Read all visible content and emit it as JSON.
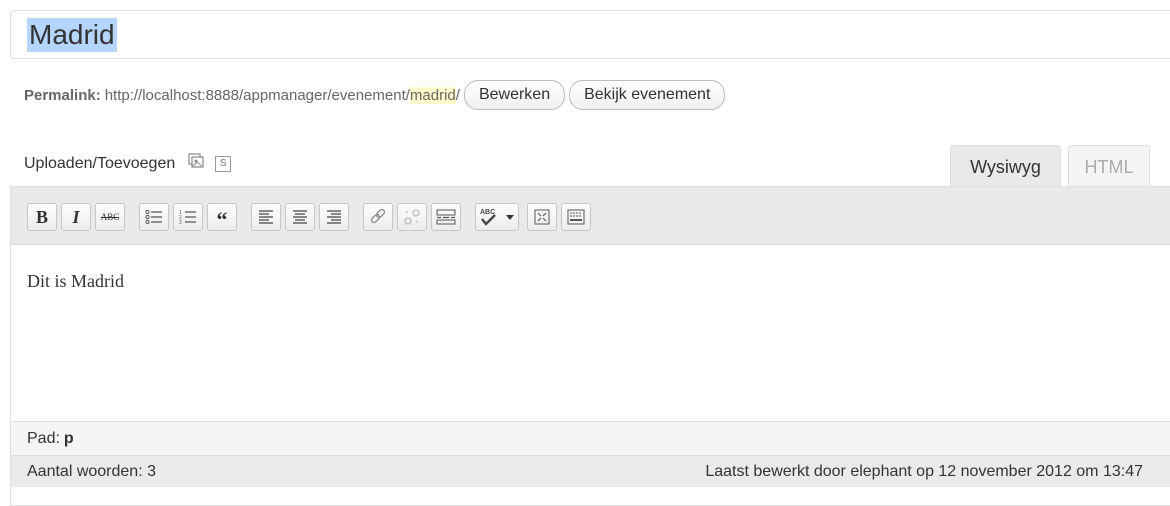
{
  "title": "Madrid",
  "permalink": {
    "label": "Permalink:",
    "url_prefix": "http://localhost:8888/appmanager/evenement/",
    "slug": "madrid",
    "url_suffix": "/",
    "edit_button": "Bewerken",
    "view_button": "Bekijk evenement"
  },
  "upload": {
    "label": "Uploaden/Toevoegen",
    "s_icon": "S"
  },
  "tabs": {
    "wysiwyg": "Wysiwyg",
    "html": "HTML"
  },
  "toolbar": {
    "bold": "B",
    "italic": "I",
    "strikethrough": "ABC",
    "blockquote": "“",
    "spellcheck": "ABC"
  },
  "content": {
    "text": "Dit is Madrid"
  },
  "path": {
    "label": "Pad:",
    "value": "p"
  },
  "status": {
    "word_count": "Aantal woorden: 3",
    "last_edited": "Laatst bewerkt door elephant op 12 november 2012 om 13:47"
  },
  "colors": {
    "selection": "#b4d5fe",
    "slug_highlight": "#fffbcc"
  }
}
